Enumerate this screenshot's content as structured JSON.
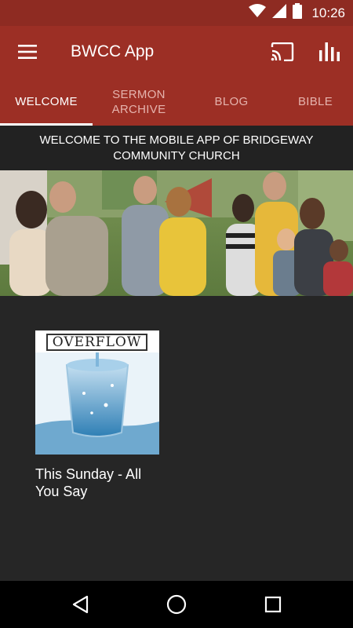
{
  "status_bar": {
    "time": "10:26",
    "icons": [
      "wifi-icon",
      "signal-icon",
      "battery-icon"
    ]
  },
  "app_bar": {
    "title": "BWCC App",
    "actions": [
      "cast-icon",
      "equalizer-icon"
    ]
  },
  "tabs": [
    {
      "label": "WELCOME",
      "active": true
    },
    {
      "label": "SERMON ARCHIVE",
      "active": false
    },
    {
      "label": "BLOG",
      "active": false
    },
    {
      "label": "BIBLE",
      "active": false
    }
  ],
  "welcome": {
    "text": "WELCOME TO THE MOBILE APP OF BRIDGEWAY COMMUNITY CHURCH"
  },
  "card": {
    "logo_text": "OVERFLOW",
    "caption": "This Sunday - All You Say"
  },
  "colors": {
    "primary": "#9c2f25",
    "status": "#8e2b22",
    "background": "#262626",
    "banner": "#222222"
  },
  "nav": [
    "back-icon",
    "home-icon",
    "recents-icon"
  ]
}
